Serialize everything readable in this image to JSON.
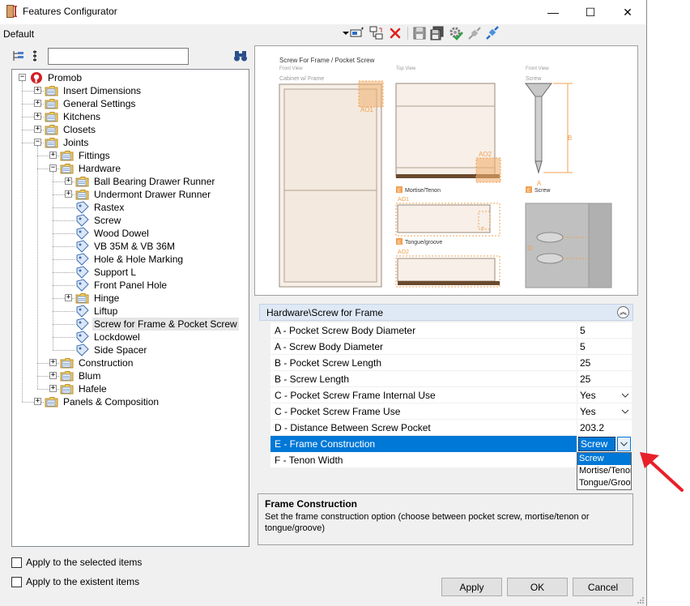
{
  "window": {
    "title": "Features Configurator",
    "controls": {
      "minimize": "—",
      "maximize": "☐",
      "close": "✕"
    }
  },
  "toolbar": {
    "profile": "Default",
    "icons": [
      "dropdown-arrow-icon",
      "apply-frame-icon",
      "copy-tree-icon",
      "delete-icon",
      "save-icon",
      "save-as-icon",
      "settings-check-icon",
      "connect-icon",
      "disconnect-icon"
    ]
  },
  "tree": {
    "search_value": "",
    "nodes": [
      {
        "label": "Promob",
        "level": 0,
        "icon": "promob-logo-icon",
        "expander": "-"
      },
      {
        "label": "Insert Dimensions",
        "level": 1,
        "icon": "folder-icon",
        "expander": "+"
      },
      {
        "label": "General Settings",
        "level": 1,
        "icon": "folder-icon",
        "expander": "+"
      },
      {
        "label": "Kitchens",
        "level": 1,
        "icon": "folder-icon",
        "expander": "+"
      },
      {
        "label": "Closets",
        "level": 1,
        "icon": "folder-icon",
        "expander": "+"
      },
      {
        "label": "Joints",
        "level": 1,
        "icon": "folder-icon",
        "expander": "-"
      },
      {
        "label": "Fittings",
        "level": 2,
        "icon": "folder-icon",
        "expander": "+"
      },
      {
        "label": "Hardware",
        "level": 2,
        "icon": "folder-icon",
        "expander": "-"
      },
      {
        "label": "Ball Bearing Drawer Runner",
        "level": 3,
        "icon": "folder-icon",
        "expander": "+"
      },
      {
        "label": "Undermont Drawer Runner",
        "level": 3,
        "icon": "folder-icon",
        "expander": "+"
      },
      {
        "label": "Rastex",
        "level": 3,
        "icon": "tag-icon",
        "expander": ""
      },
      {
        "label": "Screw",
        "level": 3,
        "icon": "tag-icon",
        "expander": ""
      },
      {
        "label": "Wood Dowel",
        "level": 3,
        "icon": "tag-icon",
        "expander": ""
      },
      {
        "label": "VB 35M & VB 36M",
        "level": 3,
        "icon": "tag-icon",
        "expander": ""
      },
      {
        "label": "Hole & Hole Marking",
        "level": 3,
        "icon": "tag-icon",
        "expander": ""
      },
      {
        "label": "Support L",
        "level": 3,
        "icon": "tag-icon",
        "expander": ""
      },
      {
        "label": "Front Panel Hole",
        "level": 3,
        "icon": "tag-icon",
        "expander": ""
      },
      {
        "label": "Hinge",
        "level": 3,
        "icon": "folder-icon",
        "expander": "+"
      },
      {
        "label": "Liftup",
        "level": 3,
        "icon": "tag-icon",
        "expander": ""
      },
      {
        "label": "Screw for Frame & Pocket Screw",
        "level": 3,
        "icon": "tag-icon",
        "expander": "",
        "selected": true
      },
      {
        "label": "Lockdowel",
        "level": 3,
        "icon": "tag-icon",
        "expander": ""
      },
      {
        "label": "Side Spacer",
        "level": 3,
        "icon": "tag-icon",
        "expander": ""
      },
      {
        "label": "Construction",
        "level": 2,
        "icon": "folder-icon",
        "expander": "+"
      },
      {
        "label": "Blum",
        "level": 2,
        "icon": "folder-icon",
        "expander": "+"
      },
      {
        "label": "Hafele",
        "level": 2,
        "icon": "folder-icon",
        "expander": "+"
      },
      {
        "label": "Panels & Composition",
        "level": 1,
        "icon": "folder-icon",
        "expander": "+"
      }
    ]
  },
  "preview": {
    "title": "Screw For Frame / Pocket Screw",
    "front_view_label": "Front View",
    "cabinet_label": "Cabinet w/ Frame",
    "top_view_label": "Top View",
    "front_view2_label": "Front View",
    "screw_label": "Screw",
    "ao1": "AO1",
    "ao2": "AO2",
    "b": "B",
    "a": "A",
    "f": "F",
    "d": "D",
    "e": "E",
    "mortise_label": "Mortise/Tenon",
    "tongue_label": "Tongue/groove",
    "screw_e_label": "Screw",
    "colors": {
      "orange": "#f0a050",
      "panel": "#f7efe8",
      "line": "#b0a090",
      "wood": "#6b4a2e"
    }
  },
  "properties": {
    "header": "Hardware\\Screw for Frame",
    "collapse_icon": "︽",
    "rows": [
      {
        "name": "A - Pocket Screw Body Diameter",
        "value": "5",
        "dropdown": false
      },
      {
        "name": "A - Screw Body Diameter",
        "value": "5",
        "dropdown": false
      },
      {
        "name": "B - Pocket Screw Length",
        "value": "25",
        "dropdown": false
      },
      {
        "name": "B - Screw Length",
        "value": "25",
        "dropdown": false
      },
      {
        "name": "C - Pocket Screw Frame Internal Use",
        "value": "Yes",
        "dropdown": true
      },
      {
        "name": "C - Pocket Screw Frame Use",
        "value": "Yes",
        "dropdown": true
      },
      {
        "name": "D - Distance Between Screw Pocket",
        "value": "203.2",
        "dropdown": false
      },
      {
        "name": "E - Frame Construction",
        "value": "Screw",
        "dropdown": true,
        "selected": true
      },
      {
        "name": "F - Tenon Width",
        "value": "",
        "dropdown": false
      }
    ],
    "dropdown_options": [
      "Screw",
      "Mortise/Tenon",
      "Tongue/Groove"
    ],
    "dropdown_highlighted": 0
  },
  "description": {
    "title": "Frame Construction",
    "body": "Set the frame construction option (choose between pocket screw, mortise/tenon or tongue/groove)"
  },
  "options": {
    "apply_selected": "Apply to the selected items",
    "apply_existent": "Apply to the existent items"
  },
  "buttons": {
    "apply": "Apply",
    "ok": "OK",
    "cancel": "Cancel"
  },
  "annotation": {
    "arrow_color": "#e8202a"
  }
}
